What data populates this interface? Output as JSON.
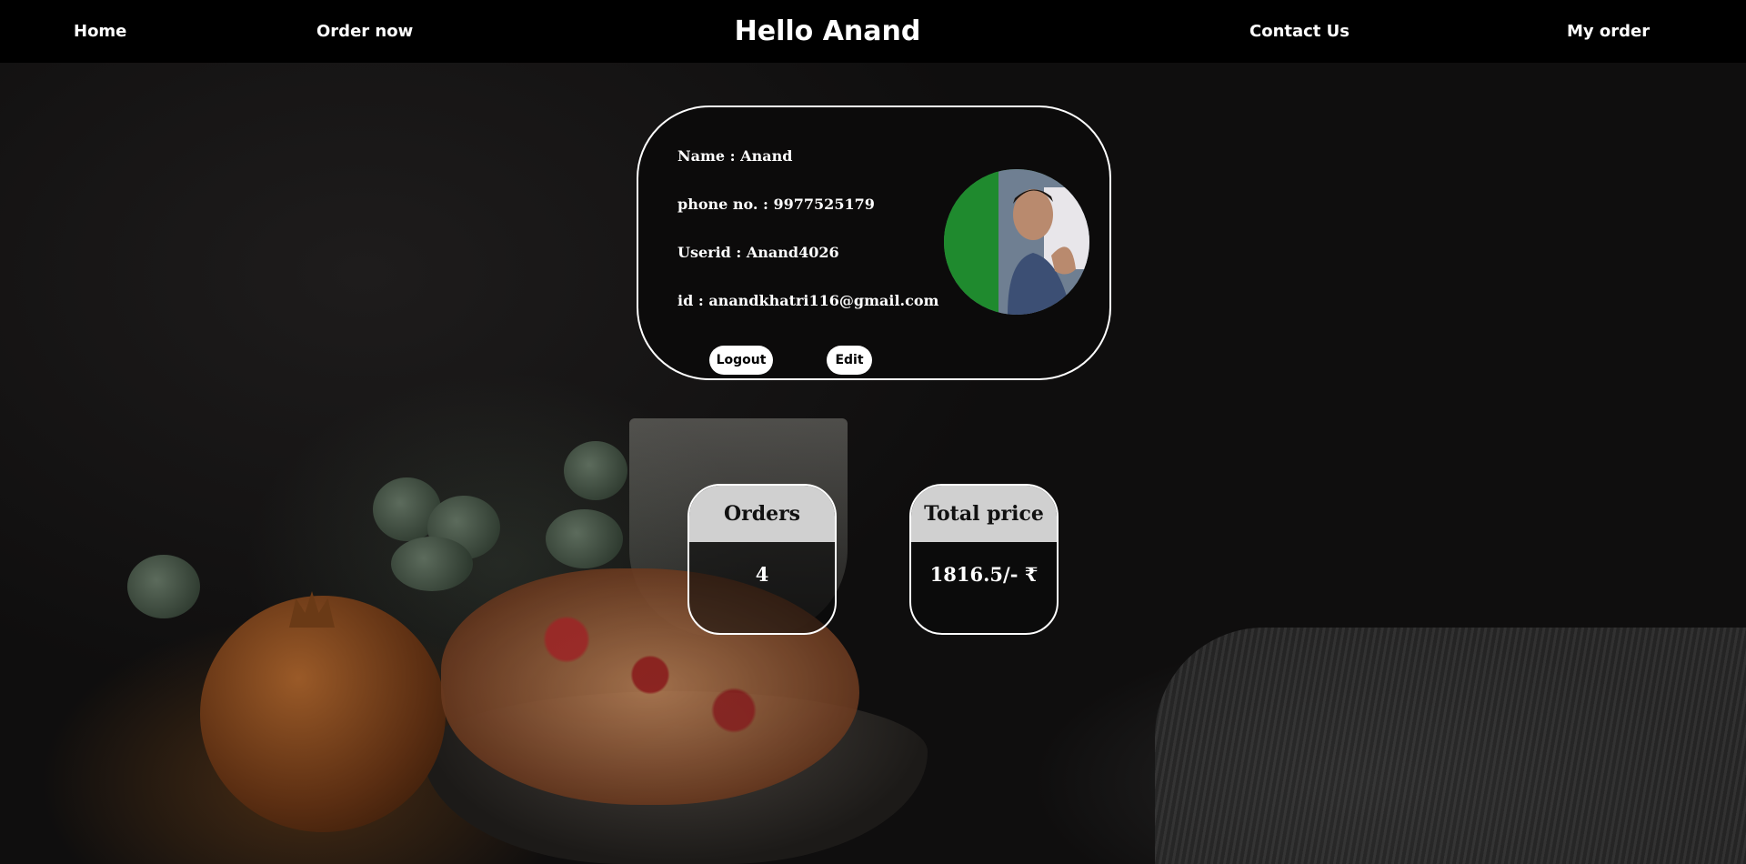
{
  "nav": {
    "home": "Home",
    "order_now": "Order now",
    "title": "Hello Anand",
    "contact_us": "Contact Us",
    "my_order": "My order"
  },
  "profile": {
    "name_line": "Name : Anand",
    "phone_line": "phone no. : 9977525179",
    "userid_line": "Userid : Anand4026",
    "email_line": "id : anandkhatri116@gmail.com",
    "logout_label": "Logout",
    "edit_label": "Edit"
  },
  "stats": {
    "orders_label": "Orders",
    "orders_value": "4",
    "total_label": "Total price",
    "total_value": "1816.5/- ₹"
  },
  "colors": {
    "navbar_bg": "#000000",
    "card_border": "#ffffff",
    "stat_header_bg": "#d0d0d0",
    "button_bg": "#ffffff"
  }
}
